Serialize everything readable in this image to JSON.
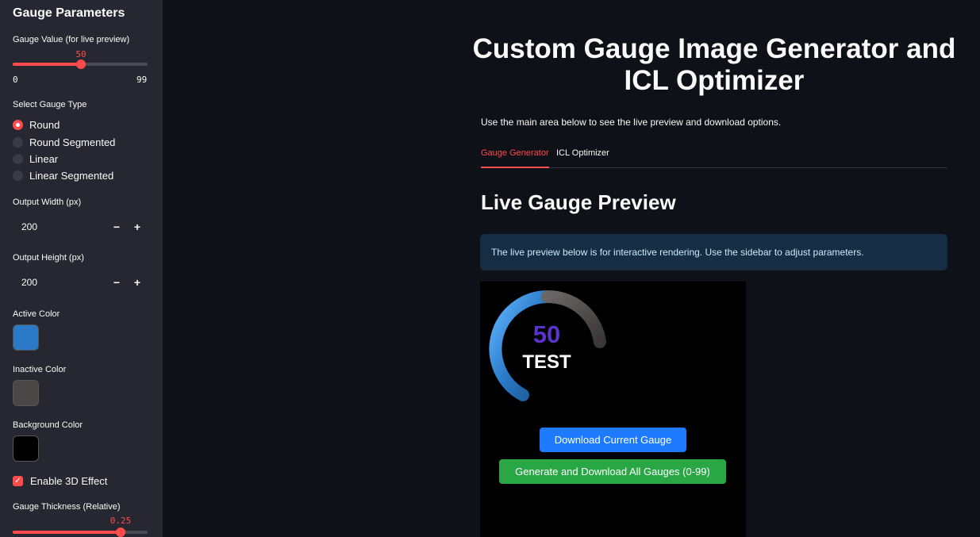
{
  "sidebar": {
    "title": "Gauge Parameters",
    "gauge_value": {
      "label": "Gauge Value (for live preview)",
      "value": "50",
      "min": "0",
      "max": "99",
      "fraction": 0.505
    },
    "gauge_type": {
      "label": "Select Gauge Type",
      "options": [
        "Round",
        "Round Segmented",
        "Linear",
        "Linear Segmented"
      ],
      "selected": "Round"
    },
    "output_width": {
      "label": "Output Width (px)",
      "value": "200",
      "minus": "−",
      "plus": "+"
    },
    "output_height": {
      "label": "Output Height (px)",
      "value": "200",
      "minus": "−",
      "plus": "+"
    },
    "active_color": {
      "label": "Active Color",
      "color": "#2a7ac7"
    },
    "inactive_color": {
      "label": "Inactive Color",
      "color": "#4a4746"
    },
    "background_color": {
      "label": "Background Color",
      "color": "#000000"
    },
    "enable_3d": {
      "label": "Enable 3D Effect",
      "checked": true,
      "check": "✓"
    },
    "thickness": {
      "label": "Gauge Thickness (Relative)",
      "value": "0.25",
      "fraction": 0.8
    }
  },
  "main": {
    "title_line1": "Custom Gauge Image Generator and",
    "title_line2": "ICL Optimizer",
    "description": "Use the main area below to see the live preview and download options.",
    "tabs": [
      {
        "label": "Gauge Generator",
        "active": true
      },
      {
        "label": "ICL Optimizer",
        "active": false
      }
    ],
    "section_title": "Live Gauge Preview",
    "info": "The live preview below is for interactive rendering. Use the sidebar to adjust parameters."
  },
  "preview": {
    "gauge_value_text": "50",
    "gauge_label": "TEST",
    "value_color": "#5a33cc",
    "download_current": "Download Current Gauge",
    "download_all": "Generate and Download All Gauges (0-99)"
  },
  "colors": {
    "accent": "#ff4b4b",
    "sidebar_bg": "#262730",
    "main_bg": "#0e1117",
    "info_bg": "#172d43"
  }
}
